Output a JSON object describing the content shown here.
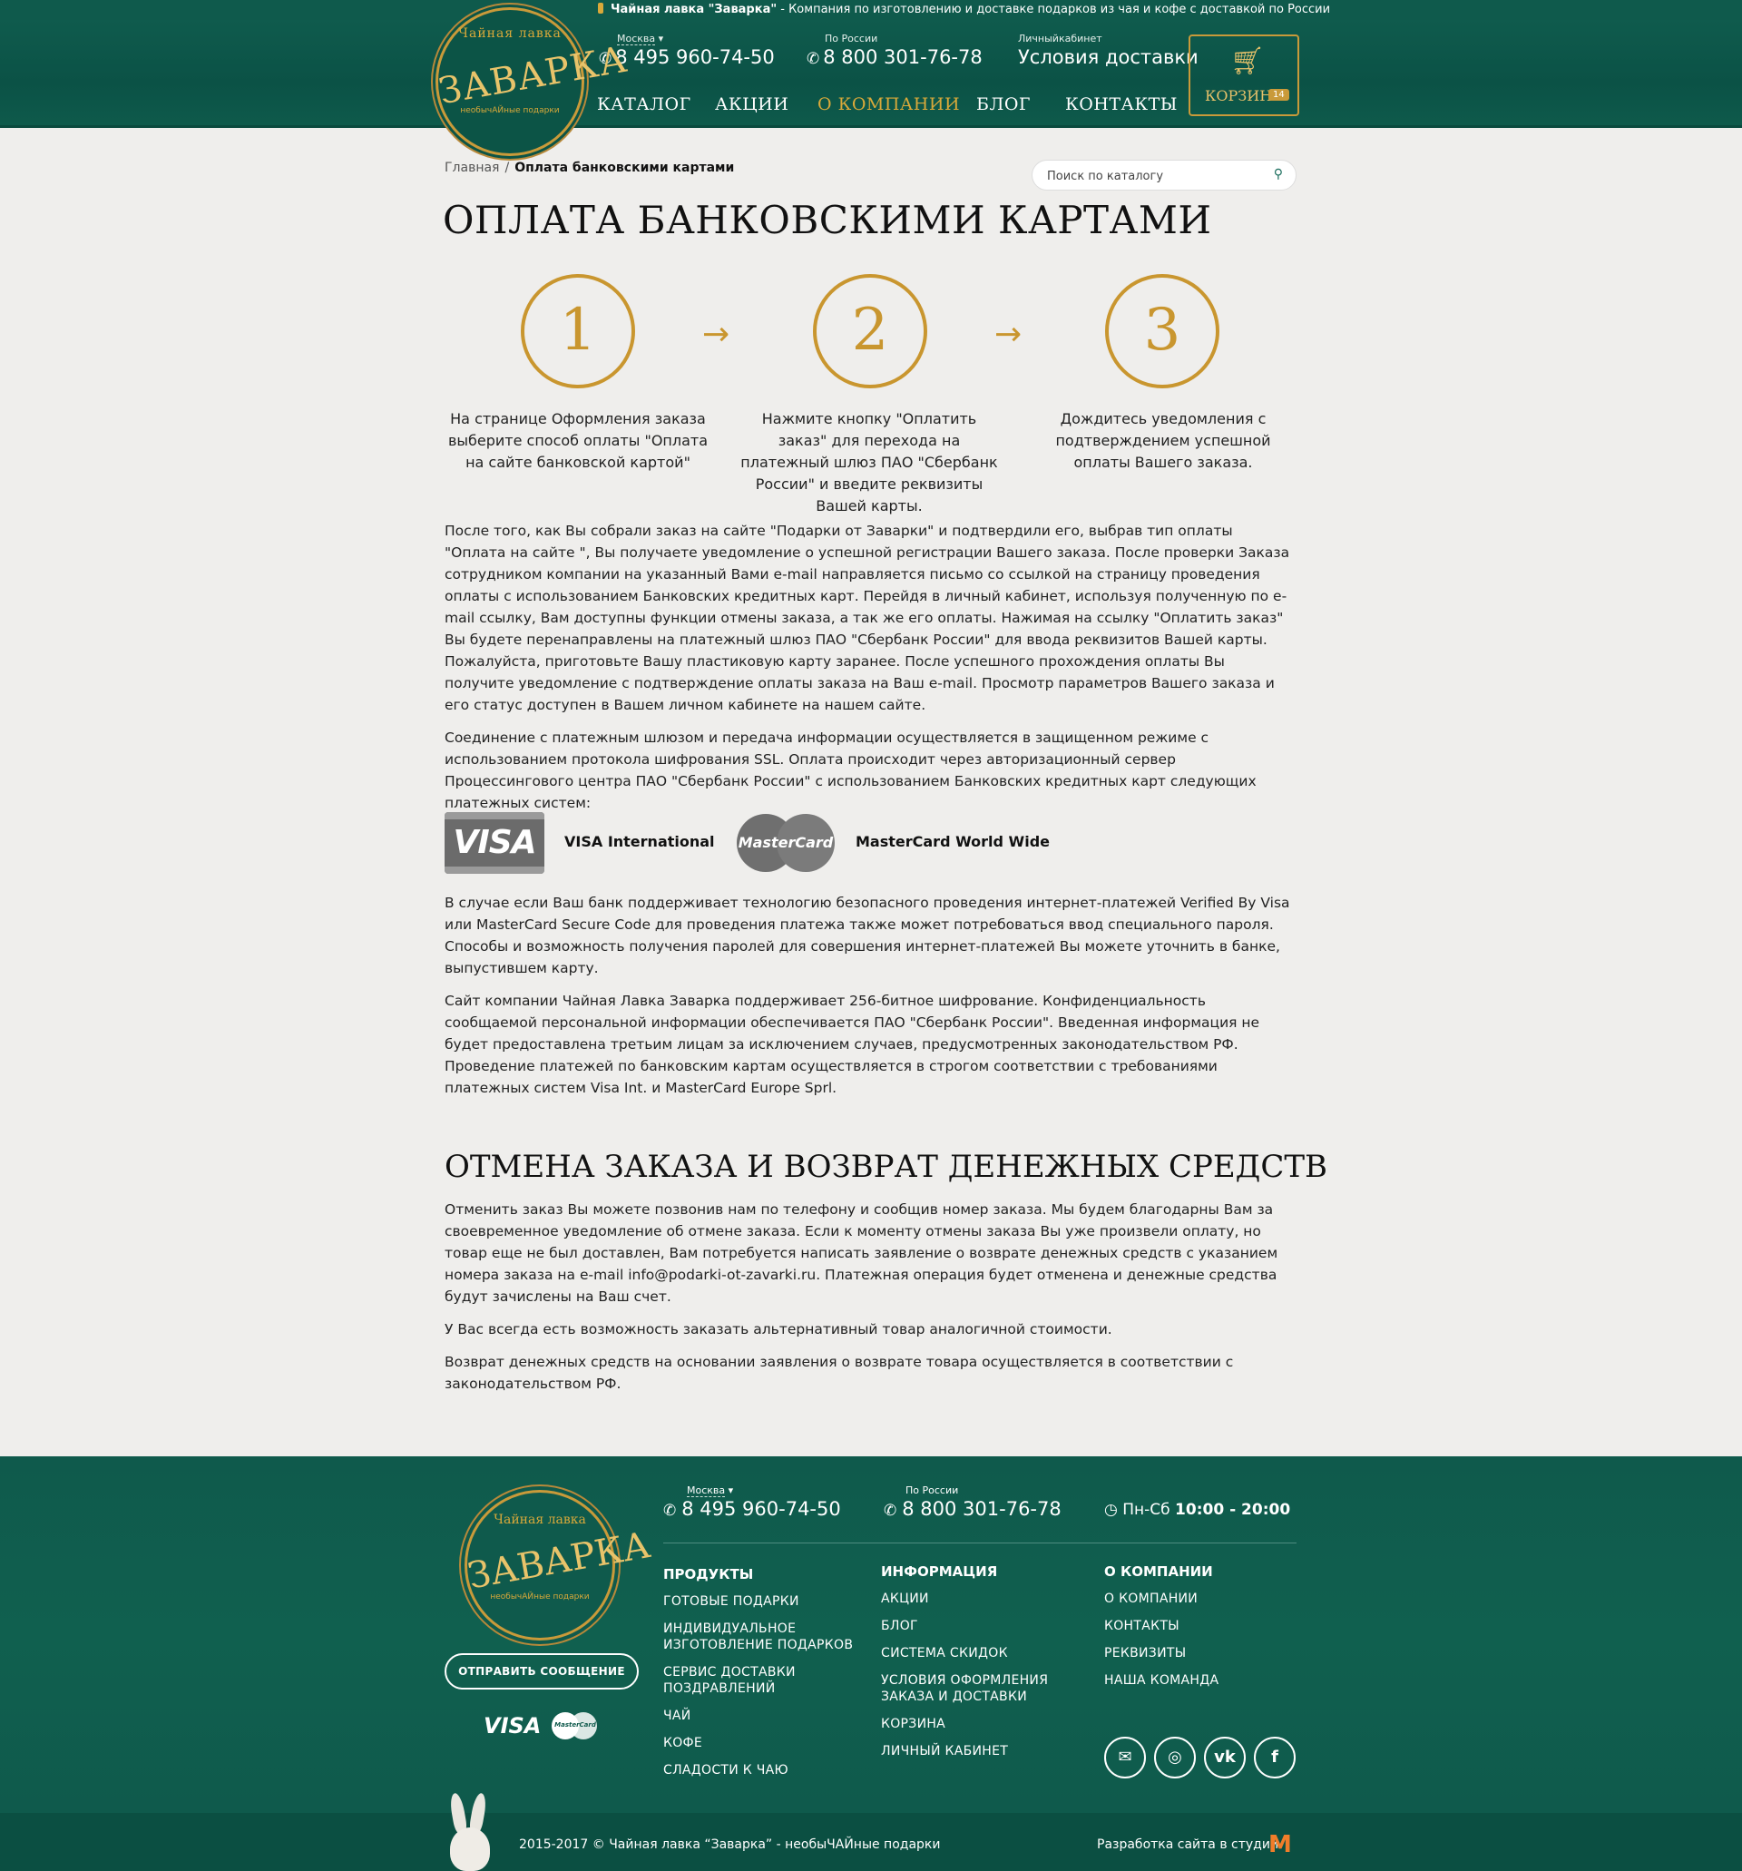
{
  "topline": {
    "brand": "Чайная лавка \"Заварка\"",
    "text": " - Компания по изготовлению и доставке подарков из чая и кофе с доставкой по России"
  },
  "logo": {
    "arc": "Чайная лавка",
    "name": "ЗАВАРКА",
    "tagline": "необычАЙные подарки"
  },
  "header": {
    "moscow_label": "Москва",
    "moscow_phone": "8 495 960-74-50",
    "russia_label": "По России",
    "russia_phone": "8 800 301-76-78",
    "account_label": "Личныйкабинет",
    "delivery": "Условия доставки",
    "cart_label": "КОРЗИНА",
    "cart_count": "14"
  },
  "nav": [
    "КАТАЛОГ",
    "АКЦИИ",
    "О КОМПАНИИ",
    "БЛОГ",
    "КОНТАКТЫ"
  ],
  "breadcrumb": {
    "home": "Главная",
    "sep": "/",
    "current": "Оплата банковскими картами"
  },
  "search": {
    "placeholder": "Поиск по каталогу"
  },
  "page": {
    "title": "ОПЛАТА БАНКОВСКИМИ КАРТАМИ",
    "steps": [
      {
        "num": "1",
        "text": "На странице Оформления заказа выберите способ оплаты \"Оплата на сайте банковской картой\""
      },
      {
        "num": "2",
        "text": "Нажмите кнопку \"Оплатить заказ\" для перехода на платежный шлюз ПАО \"Сбербанк России\" и введите реквизиты Вашей карты."
      },
      {
        "num": "3",
        "text": "Дождитесь уведомления с подтверждением успешной оплаты Вашего заказа."
      }
    ],
    "arrow": "→",
    "p1": "После того, как Вы собрали заказ на сайте \"Подарки от Заварки\" и подтвердили его, выбрав тип оплаты \"Оплата на сайте \", Вы получаете уведомление о успешной регистрации Вашего заказа. После проверки Заказа сотрудником компании на указанный Вами e-mail направляется письмо со ссылкой на страницу проведения оплаты с использованием Банковских кредитных карт. Перейдя в личный кабинет, используя полученную по e-mail ссылку, Вам доступны функции отмены заказа, а так же его оплаты. Нажимая на ссылку \"Оплатить заказ\" Вы будете перенаправлены на платежный шлюз ПАО \"Сбербанк России\" для ввода реквизитов Вашей карты. Пожалуйста, приготовьте Вашу пластиковую карту заранее. После успешного прохождения оплаты Вы получите уведомление с подтверждение оплаты заказа на Ваш e-mail. Просмотр параметров Вашего заказа и его статус доступен в Вашем личном кабинете на нашем сайте.",
    "p2": "Соединение с платежным шлюзом и передача информации осуществляется в защищенном режиме с использованием протокола шифрования SSL. Оплата происходит через авторизационный сервер Процессингового центра ПАО \"Сбербанк России\" с использованием Банковских кредитных карт следующих платежных систем:",
    "visa_logo": "VISA",
    "visa_label": "VISA International",
    "mc_logo": "MasterCard",
    "mc_label": "MasterCard World Wide",
    "p3": "В случае если Ваш банк поддерживает технологию безопасного проведения интернет-платежей Verified By Visa или MasterCard Secure Code для проведения платежа также может потребоваться ввод специального пароля. Способы и возможность получения паролей для совершения интернет-платежей Вы можете уточнить в банке, выпустившем карту.",
    "p4": "Сайт компании Чайная Лавка Заварка поддерживает 256-битное шифрование. Конфиденциальность сообщаемой персональной информации обеспечивается ПАО \"Сбербанк России\". Введенная информация не будет предоставлена третьим лицам за исключением случаев, предусмотренных законодательством РФ. Проведение платежей по банковским картам осуществляется в строгом соответствии с требованиями платежных систем Visa Int. и MasterCard Europe Sprl.",
    "section2_title": "ОТМЕНА ЗАКАЗА И ВОЗВРАТ ДЕНЕЖНЫХ СРЕДСТВ",
    "p5": "Отменить заказ Вы можете позвонив нам по телефону и сообщив номер заказа. Мы будем благодарны Вам за своевременное уведомление об отмене заказа. Если к моменту отмены заказа Вы уже произвели оплату, но товар еще не был доставлен, Вам потребуется написать заявление о возврате денежных средств с указанием номера заказа на e-mail info@podarki-ot-zavarki.ru. Платежная операция будет отменена и денежные средства будут зачислены на Ваш счет.",
    "p6": "У Вас всегда есть возможность заказать альтернативный товар аналогичной стоимости.",
    "p7": "Возврат денежных средств на основании заявления о возврате товара осуществляется в соответствии с законодательством РФ."
  },
  "footer": {
    "send_button": "ОТПРАВИТЬ СООБЩЕНИЕ",
    "visa": "VISA",
    "mastercard": "MasterCard",
    "moscow_label": "Москва",
    "moscow_phone": "8 495 960-74-50",
    "russia_label": "По России",
    "russia_phone": "8 800 301-76-78",
    "hours_days": "Пн-Сб ",
    "hours_time": "10:00 - 20:00",
    "col1": {
      "head": "ПРОДУКТЫ",
      "items": [
        "ГОТОВЫЕ ПОДАРКИ",
        "ИНДИВИДУАЛЬНОЕ ИЗГОТОВЛЕНИЕ ПОДАРКОВ",
        "СЕРВИС ДОСТАВКИ ПОЗДРАВЛЕНИЙ",
        "ЧАЙ",
        "КОФЕ",
        "СЛАДОСТИ К ЧАЮ"
      ]
    },
    "col2": {
      "head": "ИНФОРМАЦИЯ",
      "items": [
        "АКЦИИ",
        "БЛОГ",
        "СИСТЕМА СКИДОК",
        "УСЛОВИЯ ОФОРМЛЕНИЯ ЗАКАЗА И ДОСТАВКИ",
        "КОРЗИНА",
        "ЛИЧНЫЙ КАБИНЕТ"
      ]
    },
    "col3": {
      "head": "О КОМПАНИИ",
      "items": [
        "О КОМПАНИИ",
        "КОНТАКТЫ",
        "РЕКВИЗИТЫ",
        "НАША КОМАНДА"
      ]
    },
    "social": [
      {
        "icon": "mail-icon",
        "glyph": "✉"
      },
      {
        "icon": "instagram-icon",
        "glyph": "◎"
      },
      {
        "icon": "vk-icon",
        "glyph": "vk"
      },
      {
        "icon": "facebook-icon",
        "glyph": "f"
      }
    ],
    "copyright": "2015-2017 © Чайная лавка “Заварка” - необыЧАЙные подарки",
    "developer": "Разработка сайта в студии"
  },
  "colors": {
    "green": "#0f5a4c",
    "gold": "#c9962f",
    "background": "#efeeec"
  }
}
